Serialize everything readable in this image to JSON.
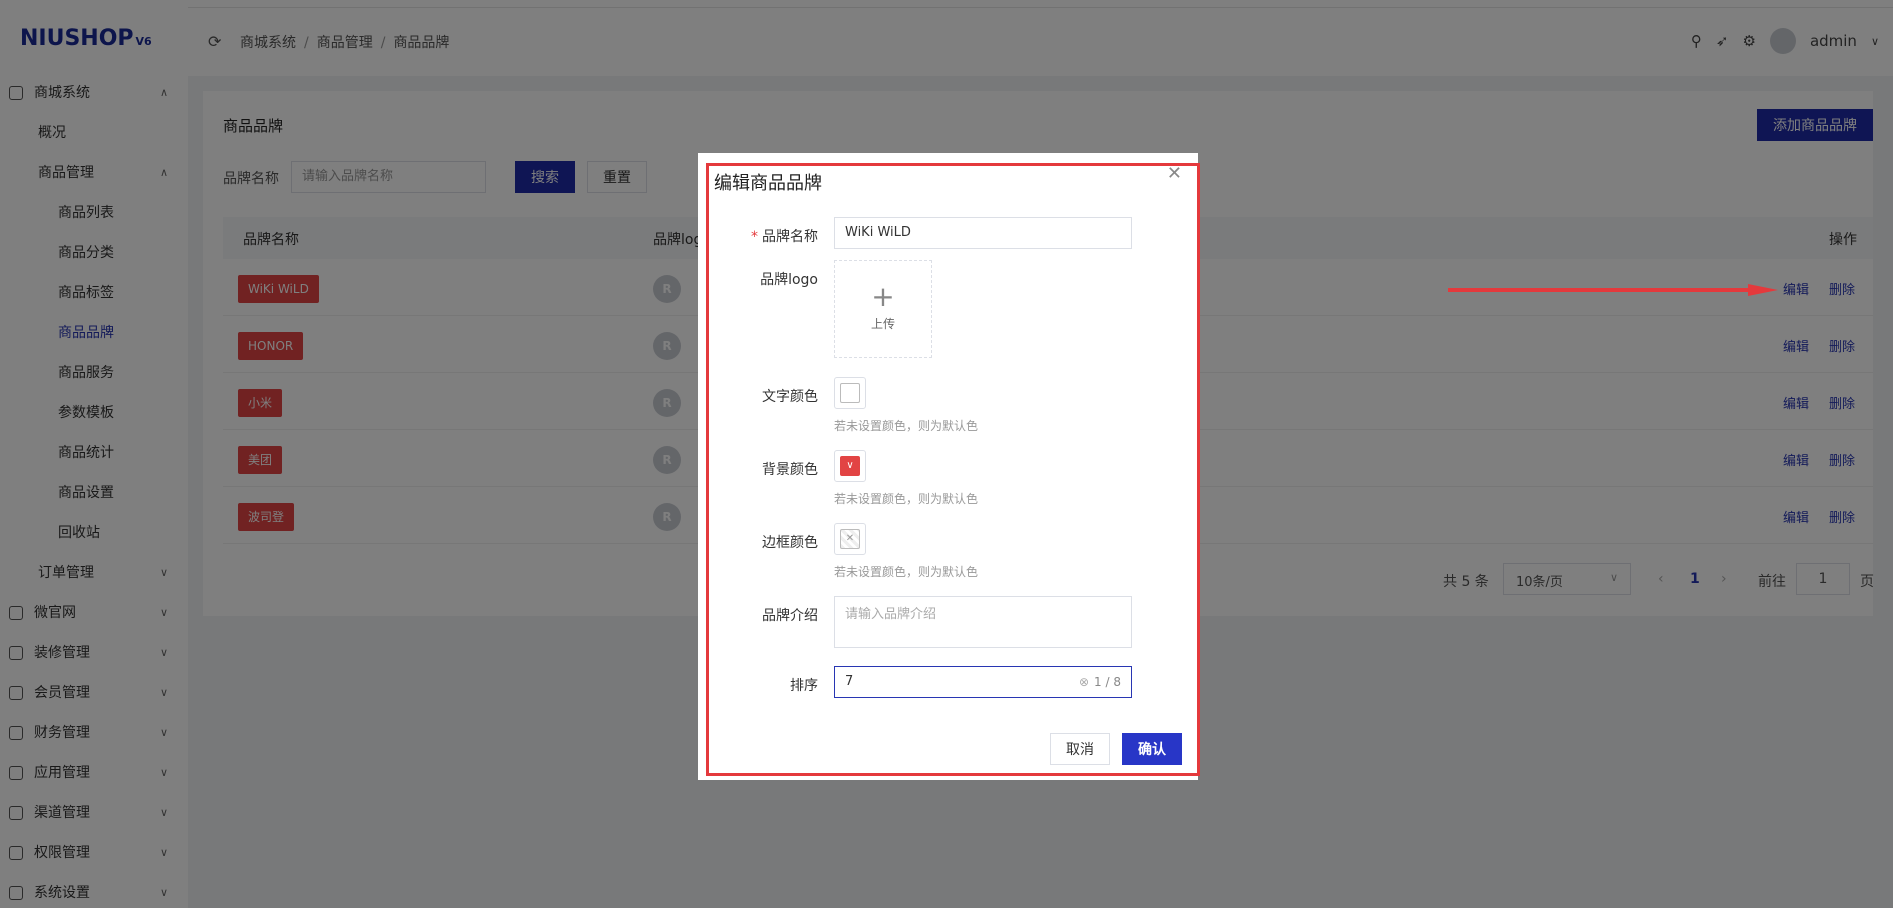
{
  "app": {
    "logo": "NIUSHOP",
    "logo_version": "V6"
  },
  "sidebar": {
    "items": [
      {
        "label": "商城系统",
        "level": 0,
        "expanded": true,
        "icon": "shop-icon"
      },
      {
        "label": "概况",
        "level": 1
      },
      {
        "label": "商品管理",
        "level": 1,
        "expanded": true
      },
      {
        "label": "商品列表",
        "level": 2
      },
      {
        "label": "商品分类",
        "level": 2
      },
      {
        "label": "商品标签",
        "level": 2
      },
      {
        "label": "商品品牌",
        "level": 2,
        "active": true
      },
      {
        "label": "商品服务",
        "level": 2
      },
      {
        "label": "参数模板",
        "level": 2
      },
      {
        "label": "商品统计",
        "level": 2
      },
      {
        "label": "商品设置",
        "level": 2
      },
      {
        "label": "回收站",
        "level": 2
      },
      {
        "label": "订单管理",
        "level": 1,
        "expanded": false
      },
      {
        "label": "微官网",
        "level": 0,
        "expanded": false,
        "icon": "globe-icon"
      },
      {
        "label": "装修管理",
        "level": 0,
        "expanded": false,
        "icon": "decor-icon"
      },
      {
        "label": "会员管理",
        "level": 0,
        "expanded": false,
        "icon": "member-icon"
      },
      {
        "label": "财务管理",
        "level": 0,
        "expanded": false,
        "icon": "finance-icon"
      },
      {
        "label": "应用管理",
        "level": 0,
        "expanded": false,
        "icon": "app-icon"
      },
      {
        "label": "渠道管理",
        "level": 0,
        "expanded": false,
        "icon": "channel-icon"
      },
      {
        "label": "权限管理",
        "level": 0,
        "expanded": false,
        "icon": "lock-icon"
      },
      {
        "label": "系统设置",
        "level": 0,
        "expanded": false,
        "icon": "settings-icon"
      }
    ]
  },
  "header": {
    "breadcrumbs": [
      "商城系统",
      "商品管理",
      "商品品牌"
    ],
    "user": "admin"
  },
  "page": {
    "title": "商品品牌",
    "add_button": "添加商品品牌",
    "filter_label": "品牌名称",
    "filter_placeholder": "请输入品牌名称",
    "search_button": "搜索",
    "reset_button": "重置",
    "columns": [
      "品牌名称",
      "品牌logo",
      "操作"
    ],
    "rows": [
      {
        "name": "WiKi WiLD",
        "logo": "R"
      },
      {
        "name": "HONOR",
        "logo": "R"
      },
      {
        "name": "小米",
        "logo": "R"
      },
      {
        "name": "美团",
        "logo": "R"
      },
      {
        "name": "波司登",
        "logo": "R"
      }
    ],
    "edit_label": "编辑",
    "delete_label": "删除",
    "pager": {
      "total": "共 5 条",
      "page_size": "10条/页",
      "current_page": "1",
      "goto_label": "前往",
      "goto_value": "1",
      "page_suffix": "页"
    }
  },
  "modal": {
    "title": "编辑商品品牌",
    "fields": {
      "name_label": "品牌名称",
      "name_value": "WiKi WiLD",
      "logo_label": "品牌logo",
      "upload_label": "上传",
      "text_color_label": "文字颜色",
      "bg_color_label": "背景颜色",
      "border_color_label": "边框颜色",
      "color_hint": "若未设置颜色，则为默认色",
      "intro_label": "品牌介绍",
      "intro_placeholder": "请输入品牌介绍",
      "sort_label": "排序",
      "sort_value": "7",
      "sort_counter": "1 / 8"
    },
    "cancel_button": "取消",
    "confirm_button": "确认"
  },
  "colors": {
    "primary": "#1f2aa8",
    "tag_red": "#e24444",
    "bg_color_swatch": "#e24444",
    "highlight_red": "#e4393c"
  }
}
